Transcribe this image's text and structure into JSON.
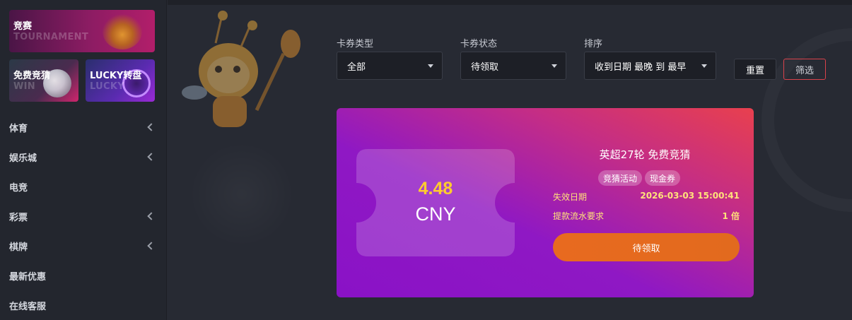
{
  "sidebar": {
    "promos": [
      {
        "title": "竞赛",
        "sub": "TOURNAMENT"
      },
      {
        "title": "免费竞猜",
        "sub": "WIN"
      },
      {
        "title": "LUCKY转盘",
        "sub": "LUCKY"
      }
    ],
    "nav": [
      {
        "label": "体育",
        "has_arrow": true
      },
      {
        "label": "娱乐城",
        "has_arrow": true
      },
      {
        "label": "电竞",
        "has_arrow": false
      },
      {
        "label": "彩票",
        "has_arrow": true
      },
      {
        "label": "棋牌",
        "has_arrow": true
      },
      {
        "label": "最新优惠",
        "has_arrow": false
      },
      {
        "label": "在线客服",
        "has_arrow": false
      }
    ]
  },
  "filters": {
    "type": {
      "label": "卡券类型",
      "value": "全部"
    },
    "status": {
      "label": "卡券状态",
      "value": "待领取"
    },
    "sort": {
      "label": "排序",
      "value": "收到日期 最晚 到 最早"
    },
    "reset_label": "重置",
    "filter_label": "筛选"
  },
  "coupon": {
    "amount": "4.48",
    "currency": "CNY",
    "title": "英超27轮 免费竞猜",
    "tags": [
      "竞猜活动",
      "现金券"
    ],
    "expiry_label": "失效日期",
    "expiry_value": "2026-03-03 15:00:41",
    "turnover_label": "提款流水要求",
    "turnover_value": "1 倍",
    "claim_label": "待领取"
  },
  "colors": {
    "accent_yellow": "#ffcc2e",
    "claim_orange": "#e86a1f",
    "filter_border": "#d9424b"
  }
}
